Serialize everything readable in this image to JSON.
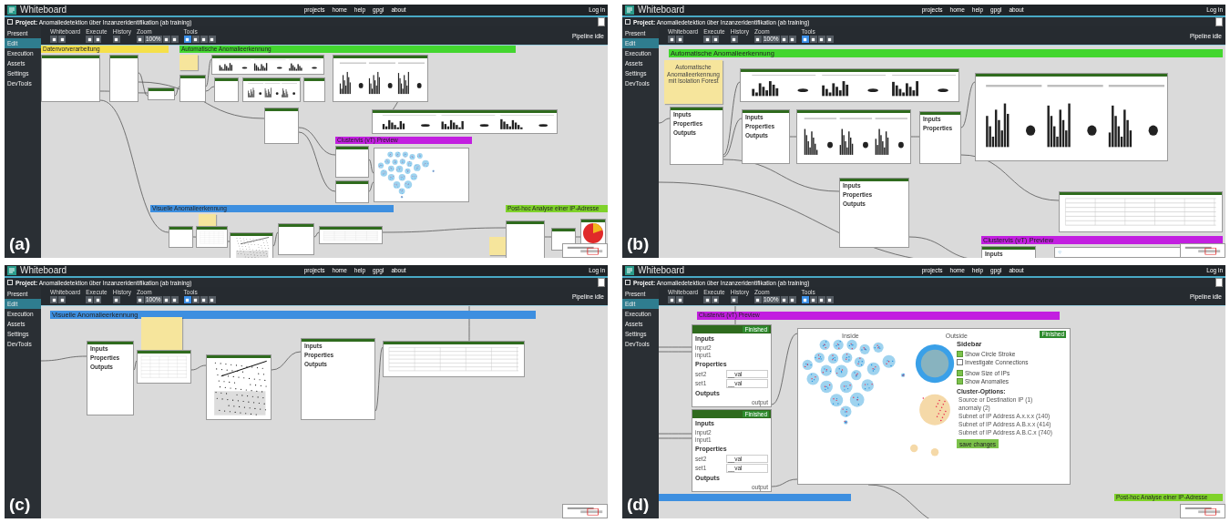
{
  "panels": [
    {
      "label": "(a)",
      "header": {
        "title": "Whiteboard",
        "nav": [
          "projects",
          "home",
          "help",
          "gpgl",
          "about"
        ],
        "login": "Log in",
        "project": "**Project:** Anomaliedetektion über Inzanzeridentifikation (ab training)",
        "status": "Pipeline idle",
        "sidebar": [
          {
            "label": "Present",
            "selected": false
          },
          {
            "label": "Edit",
            "selected": true
          },
          {
            "label": "Execution",
            "selected": false
          },
          {
            "label": "Assets",
            "selected": false
          },
          {
            "label": "Settings",
            "selected": false
          },
          {
            "label": "DevTools",
            "selected": false
          }
        ],
        "toolbar": [
          {
            "label": "Whiteboard",
            "items": [
              {
                "kind": "icon"
              },
              {
                "kind": "icon"
              }
            ]
          },
          {
            "label": "Execute",
            "items": [
              {
                "kind": "icon"
              },
              {
                "kind": "icon"
              }
            ]
          },
          {
            "label": "History",
            "items": [
              {
                "kind": "icon"
              }
            ]
          },
          {
            "label": "Zoom",
            "items": [
              {
                "kind": "icon"
              },
              {
                "kind": "text",
                "text": "100%"
              },
              {
                "kind": "icon"
              },
              {
                "kind": "icon"
              }
            ]
          },
          {
            "label": "Tools",
            "items": [
              {
                "kind": "icon",
                "selected": true
              },
              {
                "kind": "icon",
                "selected": false
              },
              {
                "kind": "icon",
                "selected": false
              },
              {
                "kind": "icon",
                "selected": false
              }
            ]
          }
        ]
      },
      "canvas": {
        "banners": [
          {
            "text": "Datenvorverarbeitung",
            "color": "#f5e04a"
          },
          {
            "text": "Automatische Anomalieerkennung",
            "color": "#43d62f"
          },
          {
            "text": "Clustervis (vT) Preview",
            "color": "#c21fe0"
          },
          {
            "text": "Visuelle Anomalieerkennung",
            "color": "#3d8fe0"
          },
          {
            "text": "Post-hoc Analyse einer IP-Adresse",
            "color": "#7fd22a"
          }
        ],
        "notes": [
          {
            "kind": "sticky"
          },
          {
            "kind": "sticky"
          },
          {
            "kind": "sticky"
          }
        ],
        "nodes": [
          {
            "kind": "blank"
          },
          {
            "kind": "blank"
          },
          {
            "kind": "blank"
          },
          {
            "kind": "blank"
          },
          {
            "kind": "chart"
          },
          {
            "kind": "blank"
          },
          {
            "kind": "chart"
          },
          {
            "kind": "blank"
          },
          {
            "kind": "chart"
          },
          {
            "kind": "blank"
          },
          {
            "kind": "chart"
          },
          {
            "kind": "blank"
          },
          {
            "kind": "blank"
          },
          {
            "kind": "cluster"
          },
          {
            "kind": "blank"
          },
          {
            "kind": "table"
          },
          {
            "kind": "scatter"
          },
          {
            "kind": "blank"
          },
          {
            "kind": "table"
          },
          {
            "kind": "blank"
          },
          {
            "kind": "blank"
          },
          {
            "kind": "pie"
          }
        ]
      }
    },
    {
      "label": "(b)",
      "header": {
        "title": "Whiteboard",
        "nav": [
          "projects",
          "home",
          "help",
          "gpgl",
          "about"
        ],
        "login": "Log in",
        "project": "**Project:** Anomaliedetektion über Inzanzeridentifikation (ab training)",
        "status": "Pipeline idle",
        "sidebar": [
          {
            "label": "Present",
            "selected": false
          },
          {
            "label": "Edit",
            "selected": true
          },
          {
            "label": "Execution",
            "selected": false
          },
          {
            "label": "Assets",
            "selected": false
          },
          {
            "label": "Settings",
            "selected": false
          },
          {
            "label": "DevTools",
            "selected": false
          }
        ],
        "toolbar": [
          {
            "label": "Whiteboard",
            "items": [
              {
                "kind": "icon"
              },
              {
                "kind": "icon"
              }
            ]
          },
          {
            "label": "Execute",
            "items": [
              {
                "kind": "icon"
              },
              {
                "kind": "icon"
              }
            ]
          },
          {
            "label": "History",
            "items": [
              {
                "kind": "icon"
              }
            ]
          },
          {
            "label": "Zoom",
            "items": [
              {
                "kind": "icon"
              },
              {
                "kind": "text",
                "text": "100%"
              },
              {
                "kind": "icon"
              },
              {
                "kind": "icon"
              }
            ]
          },
          {
            "label": "Tools",
            "items": [
              {
                "kind": "icon",
                "selected": true
              },
              {
                "kind": "icon",
                "selected": false
              },
              {
                "kind": "icon",
                "selected": false
              },
              {
                "kind": "icon",
                "selected": false
              }
            ]
          }
        ]
      },
      "canvas": {
        "banners": [
          {
            "text": "Automatische Anomalieerkennung",
            "color": "#43d62f"
          },
          {
            "text": "Clustervis (vT) Preview",
            "color": "#c21fe0"
          }
        ],
        "notes": [
          {
            "kind": "sticky",
            "text": "Automatische Anomalieerkennung mit Isolation Forest"
          }
        ],
        "nodes": [
          {
            "kind": "form",
            "sections": [
              {
                "heading": "Inputs"
              },
              {
                "heading": "Properties"
              },
              {
                "heading": "Outputs"
              }
            ]
          },
          {
            "kind": "chart"
          },
          {
            "kind": "chart"
          },
          {
            "kind": "form",
            "sections": [
              {
                "heading": "Inputs"
              },
              {
                "heading": "Properties"
              },
              {
                "heading": "Outputs"
              }
            ]
          },
          {
            "kind": "chart"
          },
          {
            "kind": "form",
            "sections": [
              {
                "heading": "Inputs"
              },
              {
                "heading": "Properties"
              }
            ]
          },
          {
            "kind": "form",
            "sections": [
              {
                "heading": "Inputs"
              },
              {
                "heading": "Properties"
              },
              {
                "heading": "Outputs"
              }
            ]
          },
          {
            "kind": "table"
          },
          {
            "kind": "form",
            "sections": [
              {
                "heading": "Inputs"
              }
            ]
          },
          {
            "kind": "cluster"
          }
        ]
      }
    },
    {
      "label": "(c)",
      "header": {
        "title": "Whiteboard",
        "nav": [
          "projects",
          "home",
          "help",
          "gpgl",
          "about"
        ],
        "login": "Log in",
        "project": "**Project:** Anomaliedetektion über Inzanzeridentifikation (ab training)",
        "status": "Pipeline idle",
        "sidebar": [
          {
            "label": "Present",
            "selected": false
          },
          {
            "label": "Edit",
            "selected": true
          },
          {
            "label": "Execution",
            "selected": false
          },
          {
            "label": "Assets",
            "selected": false
          },
          {
            "label": "Settings",
            "selected": false
          },
          {
            "label": "DevTools",
            "selected": false
          }
        ],
        "toolbar": [
          {
            "label": "Whiteboard",
            "items": [
              {
                "kind": "icon"
              },
              {
                "kind": "icon"
              }
            ]
          },
          {
            "label": "Execute",
            "items": [
              {
                "kind": "icon"
              },
              {
                "kind": "icon"
              }
            ]
          },
          {
            "label": "History",
            "items": [
              {
                "kind": "icon"
              }
            ]
          },
          {
            "label": "Zoom",
            "items": [
              {
                "kind": "icon"
              },
              {
                "kind": "text",
                "text": "100%"
              },
              {
                "kind": "icon"
              },
              {
                "kind": "icon"
              }
            ]
          },
          {
            "label": "Tools",
            "items": [
              {
                "kind": "icon",
                "selected": true
              },
              {
                "kind": "icon",
                "selected": false
              },
              {
                "kind": "icon",
                "selected": false
              },
              {
                "kind": "icon",
                "selected": false
              }
            ]
          }
        ]
      },
      "canvas": {
        "banners": [
          {
            "text": "Visuelle Anomalieerkennung",
            "color": "#3d8fe0"
          }
        ],
        "notes": [
          {
            "kind": "sticky"
          }
        ],
        "nodes": [
          {
            "kind": "form",
            "sections": [
              {
                "heading": "Inputs"
              },
              {
                "heading": "Properties"
              },
              {
                "heading": "Outputs"
              }
            ]
          },
          {
            "kind": "table"
          },
          {
            "kind": "scatter"
          },
          {
            "kind": "form",
            "sections": [
              {
                "heading": "Inputs"
              },
              {
                "heading": "Properties"
              },
              {
                "heading": "Outputs"
              }
            ]
          },
          {
            "kind": "table"
          }
        ]
      }
    },
    {
      "label": "(d)",
      "header": {
        "title": "Whiteboard",
        "nav": [
          "projects",
          "home",
          "help",
          "gpgl",
          "about"
        ],
        "login": "Log in",
        "project": "**Project:** Anomaliedetektion über Inzanzeridentifikation (ab training)",
        "status": "Pipeline idle",
        "sidebar": [
          {
            "label": "Present",
            "selected": false
          },
          {
            "label": "Edit",
            "selected": true
          },
          {
            "label": "Execution",
            "selected": false
          },
          {
            "label": "Assets",
            "selected": false
          },
          {
            "label": "Settings",
            "selected": false
          },
          {
            "label": "DevTools",
            "selected": false
          }
        ],
        "toolbar": [
          {
            "label": "Whiteboard",
            "items": [
              {
                "kind": "icon"
              },
              {
                "kind": "icon"
              }
            ]
          },
          {
            "label": "Execute",
            "items": [
              {
                "kind": "icon"
              },
              {
                "kind": "icon"
              }
            ]
          },
          {
            "label": "History",
            "items": [
              {
                "kind": "icon"
              }
            ]
          },
          {
            "label": "Zoom",
            "items": [
              {
                "kind": "icon"
              },
              {
                "kind": "text",
                "text": "100%"
              },
              {
                "kind": "icon"
              },
              {
                "kind": "icon"
              }
            ]
          },
          {
            "label": "Tools",
            "items": [
              {
                "kind": "icon",
                "selected": true
              },
              {
                "kind": "icon",
                "selected": false
              },
              {
                "kind": "icon",
                "selected": false
              },
              {
                "kind": "icon",
                "selected": false
              }
            ]
          }
        ]
      },
      "canvas": {
        "banners": [
          {
            "text": "Clustervis (vT) Preview",
            "color": "#c21fe0"
          },
          {
            "color": "#3d8fe0"
          },
          {
            "text": "Post-hoc Analyse einer IP-Adresse",
            "color": "#7fd22a"
          }
        ],
        "nodes": [
          {
            "kind": "form",
            "status": "Finished",
            "sections": [
              {
                "heading": "Inputs",
                "items": [
                  {
                    "label": "input2"
                  },
                  {
                    "label": "input1"
                  }
                ]
              },
              {
                "heading": "Properties",
                "items": [
                  {
                    "label": "set2",
                    "value": "__val"
                  },
                  {
                    "label": "set1",
                    "value": "__val"
                  }
                ]
              },
              {
                "heading": "Outputs",
                "items": [
                  {
                    "label": "output",
                    "kind": "output"
                  }
                ]
              }
            ]
          },
          {
            "kind": "form",
            "status": "Finished",
            "sections": [
              {
                "heading": "Inputs",
                "items": [
                  {
                    "label": "input2"
                  },
                  {
                    "label": "input1"
                  }
                ]
              },
              {
                "heading": "Properties",
                "items": [
                  {
                    "label": "set2",
                    "value": "__val"
                  },
                  {
                    "label": "set1",
                    "value": "__val"
                  }
                ]
              },
              {
                "heading": "Outputs",
                "items": [
                  {
                    "label": "output",
                    "kind": "output"
                  }
                ]
              }
            ]
          },
          {
            "kind": "cluster",
            "status": "Finished",
            "areas": [
              "Inside",
              "Outside"
            ],
            "sidebar": {
              "title": "Sidebar",
              "options": [
                {
                  "label": "Show Circle Stroke",
                  "checked": true
                },
                {
                  "label": "Investigate Connections",
                  "checked": false
                },
                {
                  "label": "Show Size of IPs",
                  "checked": true
                },
                {
                  "label": "Show Anomalies",
                  "checked": true
                }
              ],
              "subtitle": "Cluster-Options:",
              "choices": [
                "Source or Destination IP (1)",
                "anomaly (2)",
                "Subnet of IP Address A.x.x.x (140)",
                "Subnet of IP Address A.B.x.x (414)",
                "Subnet of IP Address A.B.C.x (740)"
              ],
              "button": "save changes"
            }
          }
        ]
      }
    }
  ]
}
